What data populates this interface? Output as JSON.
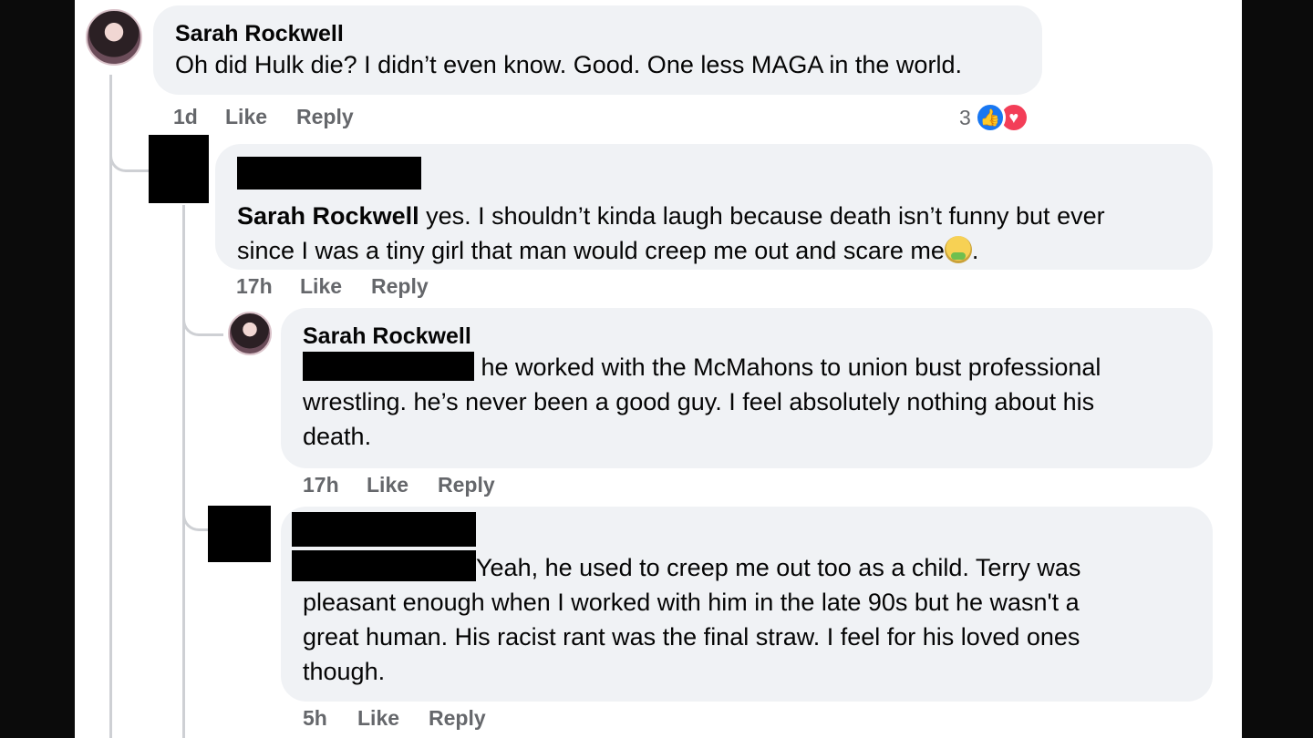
{
  "comments": [
    {
      "author": "Sarah Rockwell",
      "text": "Oh did Hulk die? I didn’t even know. Good. One less MAGA in the world.",
      "time": "1d",
      "like_label": "Like",
      "reply_label": "Reply",
      "reaction_count": "3"
    },
    {
      "mention": "Sarah Rockwell",
      "text_line1": " yes. I shouldn’t kinda laugh because death isn’t funny but ever",
      "text_line2": "since I was a tiny girl that man would creep me out and scare me",
      "text_end": ".",
      "time": "17h",
      "like_label": "Like",
      "reply_label": "Reply"
    },
    {
      "author": "Sarah Rockwell",
      "text_line1": " he worked with the McMahons to union bust professional",
      "text_line2": "wrestling. he’s never been a good guy. I feel absolutely nothing about his",
      "text_line3": "death.",
      "time": "17h",
      "like_label": "Like",
      "reply_label": "Reply"
    },
    {
      "text_line1": "Yeah, he used to creep me out too as a child. Terry was",
      "text_line2": "pleasant enough when I worked with him in the late 90s but he wasn't a",
      "text_line3": "great human. His racist rant was the final straw. I feel for his loved ones",
      "text_line4": "though.",
      "time": "5h",
      "like_label": "Like",
      "reply_label": "Reply"
    }
  ],
  "colors": {
    "bubble": "#f0f2f5",
    "meta": "#65676b",
    "like_reaction": "#1877f2",
    "love_reaction": "#f33e58"
  },
  "icons": [
    "thumbs-up-icon",
    "heart-icon",
    "nauseated-face-emoji"
  ]
}
